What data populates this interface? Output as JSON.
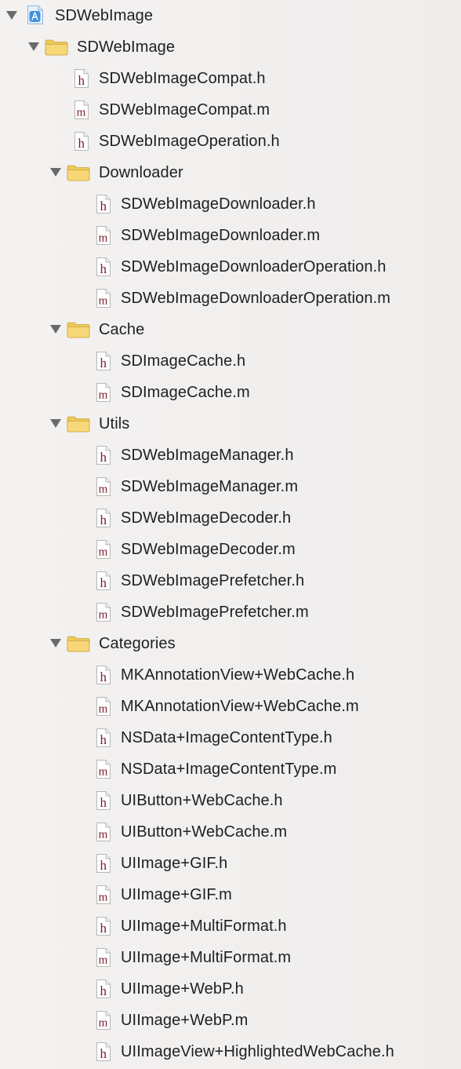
{
  "project": {
    "name": "SDWebImage",
    "icon": "xcode-project-icon"
  },
  "tree": [
    {
      "type": "project",
      "name": "SDWebImage",
      "depth": 0,
      "expanded": true
    },
    {
      "type": "group",
      "name": "SDWebImage",
      "depth": 1,
      "expanded": true
    },
    {
      "type": "file",
      "kind": "h",
      "name": "SDWebImageCompat.h",
      "depth": 2
    },
    {
      "type": "file",
      "kind": "m",
      "name": "SDWebImageCompat.m",
      "depth": 2
    },
    {
      "type": "file",
      "kind": "h",
      "name": "SDWebImageOperation.h",
      "depth": 2
    },
    {
      "type": "group",
      "name": "Downloader",
      "depth": 2,
      "expanded": true
    },
    {
      "type": "file",
      "kind": "h",
      "name": "SDWebImageDownloader.h",
      "depth": 3
    },
    {
      "type": "file",
      "kind": "m",
      "name": "SDWebImageDownloader.m",
      "depth": 3
    },
    {
      "type": "file",
      "kind": "h",
      "name": "SDWebImageDownloaderOperation.h",
      "depth": 3
    },
    {
      "type": "file",
      "kind": "m",
      "name": "SDWebImageDownloaderOperation.m",
      "depth": 3
    },
    {
      "type": "group",
      "name": "Cache",
      "depth": 2,
      "expanded": true
    },
    {
      "type": "file",
      "kind": "h",
      "name": "SDImageCache.h",
      "depth": 3
    },
    {
      "type": "file",
      "kind": "m",
      "name": "SDImageCache.m",
      "depth": 3
    },
    {
      "type": "group",
      "name": "Utils",
      "depth": 2,
      "expanded": true
    },
    {
      "type": "file",
      "kind": "h",
      "name": "SDWebImageManager.h",
      "depth": 3
    },
    {
      "type": "file",
      "kind": "m",
      "name": "SDWebImageManager.m",
      "depth": 3
    },
    {
      "type": "file",
      "kind": "h",
      "name": "SDWebImageDecoder.h",
      "depth": 3
    },
    {
      "type": "file",
      "kind": "m",
      "name": "SDWebImageDecoder.m",
      "depth": 3
    },
    {
      "type": "file",
      "kind": "h",
      "name": "SDWebImagePrefetcher.h",
      "depth": 3
    },
    {
      "type": "file",
      "kind": "m",
      "name": "SDWebImagePrefetcher.m",
      "depth": 3
    },
    {
      "type": "group",
      "name": "Categories",
      "depth": 2,
      "expanded": true
    },
    {
      "type": "file",
      "kind": "h",
      "name": "MKAnnotationView+WebCache.h",
      "depth": 3
    },
    {
      "type": "file",
      "kind": "m",
      "name": "MKAnnotationView+WebCache.m",
      "depth": 3
    },
    {
      "type": "file",
      "kind": "h",
      "name": "NSData+ImageContentType.h",
      "depth": 3
    },
    {
      "type": "file",
      "kind": "m",
      "name": "NSData+ImageContentType.m",
      "depth": 3
    },
    {
      "type": "file",
      "kind": "h",
      "name": "UIButton+WebCache.h",
      "depth": 3
    },
    {
      "type": "file",
      "kind": "m",
      "name": "UIButton+WebCache.m",
      "depth": 3
    },
    {
      "type": "file",
      "kind": "h",
      "name": "UIImage+GIF.h",
      "depth": 3
    },
    {
      "type": "file",
      "kind": "m",
      "name": "UIImage+GIF.m",
      "depth": 3
    },
    {
      "type": "file",
      "kind": "h",
      "name": "UIImage+MultiFormat.h",
      "depth": 3
    },
    {
      "type": "file",
      "kind": "m",
      "name": "UIImage+MultiFormat.m",
      "depth": 3
    },
    {
      "type": "file",
      "kind": "h",
      "name": "UIImage+WebP.h",
      "depth": 3
    },
    {
      "type": "file",
      "kind": "m",
      "name": "UIImage+WebP.m",
      "depth": 3
    },
    {
      "type": "file",
      "kind": "h",
      "name": "UIImageView+HighlightedWebCache.h",
      "depth": 3
    }
  ],
  "colors": {
    "folder_body": "#f7d778",
    "folder_tab": "#eec95a",
    "folder_edge": "#c9a53c",
    "file_glyph": "#7a1f2b",
    "project_blue": "#3d8fe0",
    "disclosure": "#6a6a6a"
  }
}
